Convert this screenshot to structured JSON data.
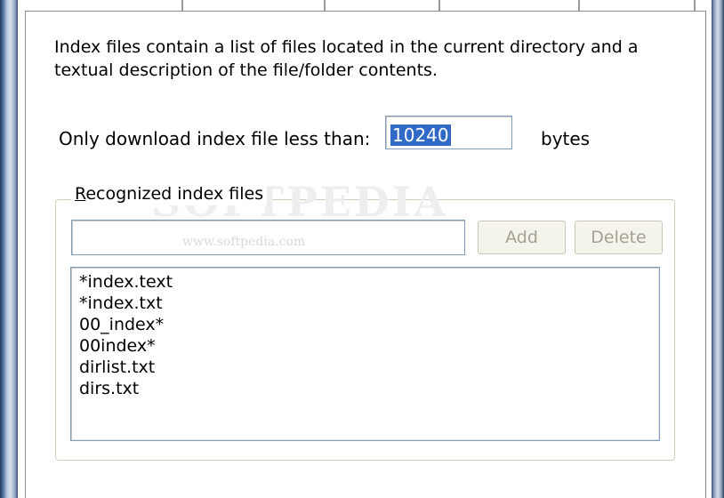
{
  "description": "Index files contain a list of files located in the current directory and a textual description of the file/folder contents.",
  "download_limit": {
    "label": "Only download index file less than:",
    "value": "10240",
    "unit": "bytes"
  },
  "group": {
    "title_first": "R",
    "title_rest": "ecognized index files",
    "new_entry_value": "",
    "add_label": "Add",
    "delete_label": "Delete",
    "items": [
      {
        "label": "*index.text"
      },
      {
        "label": "*index.txt"
      },
      {
        "label": "00_index*"
      },
      {
        "label": "00index*"
      },
      {
        "label": "dirlist.txt"
      },
      {
        "label": "dirs.txt"
      }
    ]
  },
  "watermark": {
    "brand": "SOFTPEDIA",
    "url": "www.softpedia.com"
  },
  "colors": {
    "selection": "#3169c6",
    "input_border": "#7f9db9",
    "disabled_text": "#a3a194"
  }
}
